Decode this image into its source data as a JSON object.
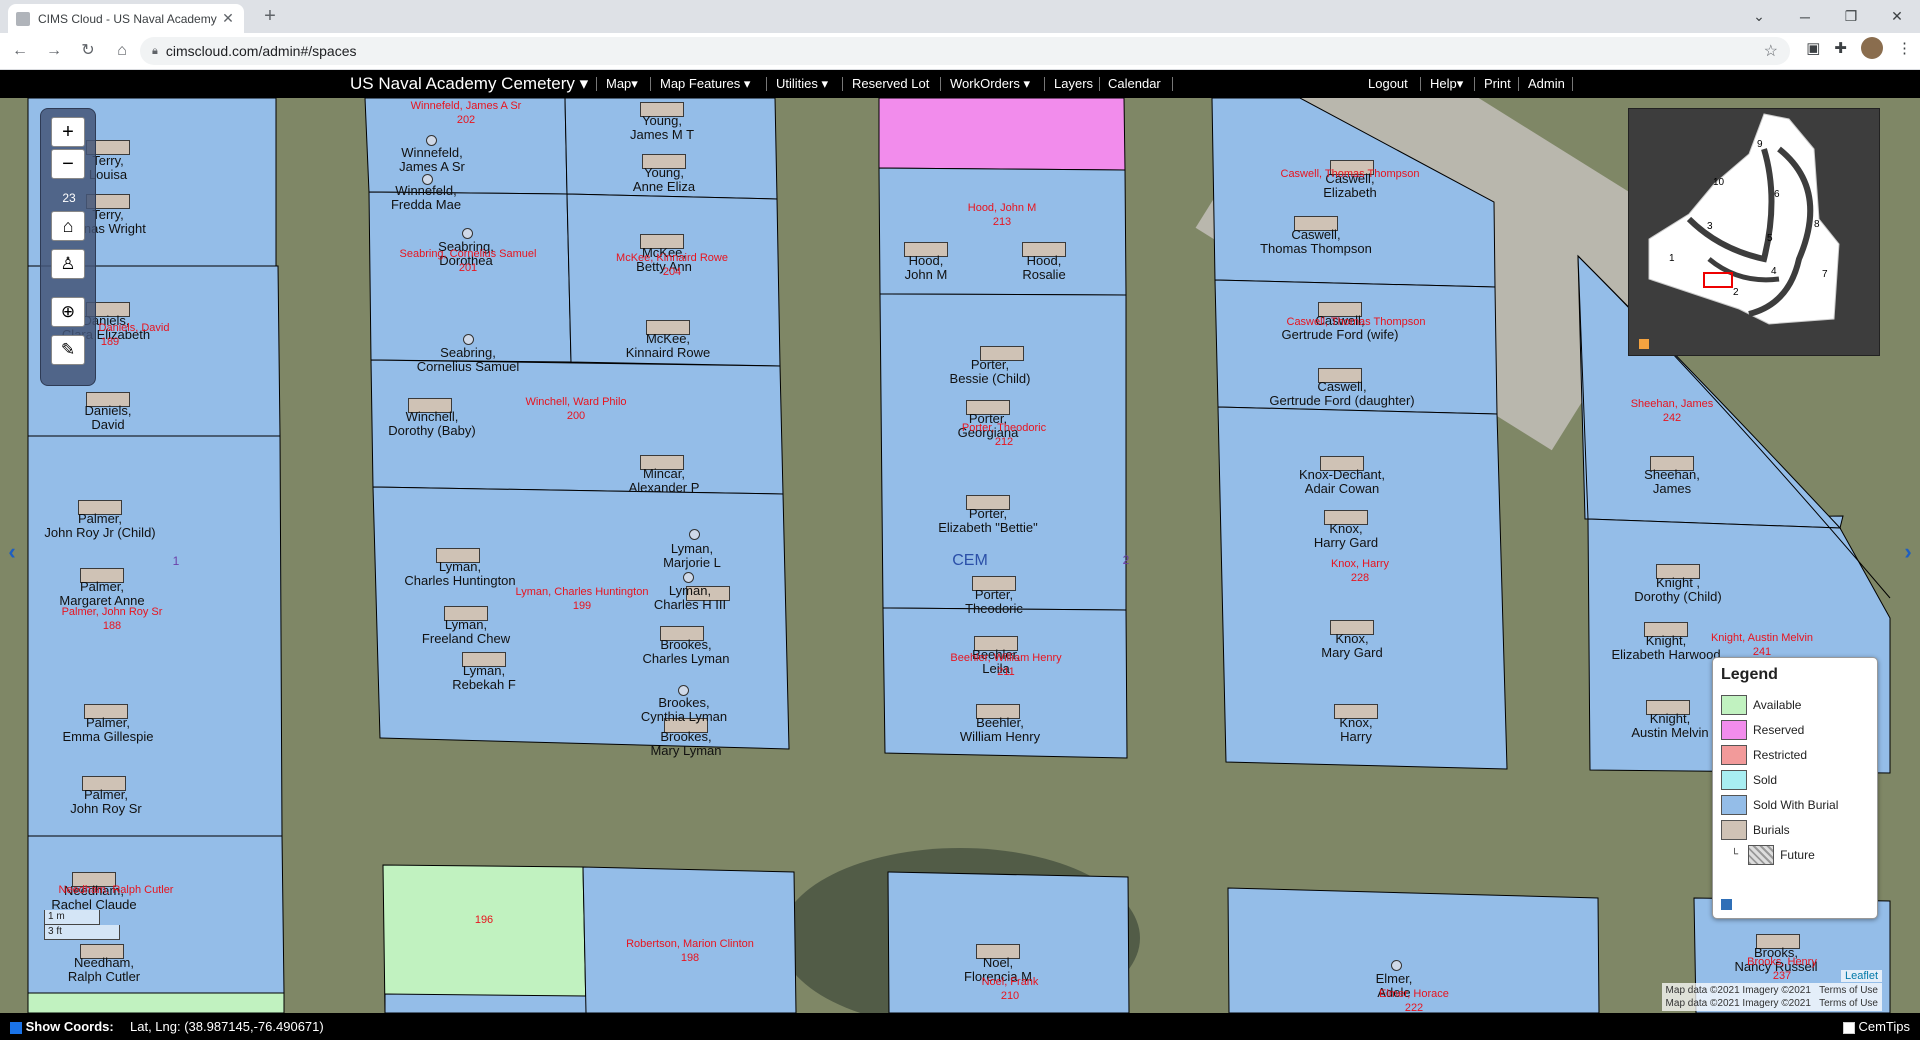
{
  "browser": {
    "tab_title": "CIMS Cloud - US Naval Academy",
    "url": "cimscloud.com/admin#/spaces"
  },
  "nav": {
    "brand": "US Naval Academy Cemetery",
    "map": "Map",
    "map_features": "Map Features",
    "utilities": "Utilities",
    "reserved_lot": "Reserved Lot",
    "work_orders": "WorkOrders",
    "layers": "Layers",
    "calendar": "Calendar",
    "logout": "Logout",
    "help": "Help",
    "print": "Print",
    "admin": "Admin"
  },
  "map": {
    "zoom_level": "23",
    "center_label": "CEM",
    "section_label_left": "1",
    "section_label_mid": "2",
    "scale": {
      "metric": "1 m",
      "imperial": "3 ft"
    },
    "attribution": [
      "Map data ©2021 Imagery ©2021",
      "Map data ©2021 Imagery ©2021"
    ],
    "terms": "Terms of Use",
    "leaflet": "Leaflet",
    "overview_numbers": [
      "9",
      "10",
      "6",
      "8",
      "3",
      "5",
      "1",
      "4",
      "7",
      "2"
    ],
    "burials": [
      {
        "name": "Terry,\nLouisa"
      },
      {
        "name": "Terry,\nJonas Wright"
      },
      {
        "name": "Daniels,\nClara Elizabeth"
      },
      {
        "name": "Daniels,\nDavid"
      },
      {
        "name": "Palmer,\nJohn Roy Jr (Child)"
      },
      {
        "name": "Palmer,\nMargaret Anne"
      },
      {
        "name": "Palmer,\nEmma Gillespie"
      },
      {
        "name": "Palmer,\nJohn Roy Sr"
      },
      {
        "name": "Needham,\nRachel Claude"
      },
      {
        "name": "Needham,\nRalph Cutler"
      },
      {
        "name": "Winnefeld,\nJames A Sr"
      },
      {
        "name": "Winnefeld,\nFredda Mae"
      },
      {
        "name": "Young,\nJames M T"
      },
      {
        "name": "Young,\nAnne Eliza"
      },
      {
        "name": "Seabring,\nDorothea"
      },
      {
        "name": "McKee,\nBetty Ann"
      },
      {
        "name": "Seabring,\nCornelius Samuel"
      },
      {
        "name": "McKee,\nKinnaird Rowe"
      },
      {
        "name": "Winchell,\nDorothy (Baby)"
      },
      {
        "name": "Mincar,\nAlexander P"
      },
      {
        "name": "Lyman,\nCharles Huntington"
      },
      {
        "name": "Lyman,\nMarjorie L"
      },
      {
        "name": "Lyman,\nCharles H III"
      },
      {
        "name": "Lyman,\nFreeland Chew"
      },
      {
        "name": "Brookes,\nCharles Lyman"
      },
      {
        "name": "Lyman,\nRebekah F"
      },
      {
        "name": "Brookes,\nCynthia Lyman"
      },
      {
        "name": "Brookes,\nMary Lyman"
      },
      {
        "name": "Hood,\nJohn M"
      },
      {
        "name": "Hood,\nRosalie"
      },
      {
        "name": "Porter,\nBessie (Child)"
      },
      {
        "name": "Porter,\nGeorgiana"
      },
      {
        "name": "Porter,\nElizabeth \"Bettie\""
      },
      {
        "name": "Porter,\nTheodoric"
      },
      {
        "name": "Beehler,\nLeila"
      },
      {
        "name": "Beehler,\nWilliam Henry"
      },
      {
        "name": "Caswell,\nElizabeth"
      },
      {
        "name": "Caswell,\nThomas Thompson"
      },
      {
        "name": "Caswell,\nGertrude Ford (wife)"
      },
      {
        "name": "Caswell,\nGertrude Ford (daughter)"
      },
      {
        "name": "Knox-Dechant,\nAdair Cowan"
      },
      {
        "name": "Knox,\nHarry Gard"
      },
      {
        "name": "Knox,\nMary Gard"
      },
      {
        "name": "Knox,\nHarry"
      },
      {
        "name": "Sheehan,\nJames"
      },
      {
        "name": "Knight ,\nDorothy (Child)"
      },
      {
        "name": "Knight,\nElizabeth Harwood"
      },
      {
        "name": "Knight,\nAustin Melvin"
      },
      {
        "name": "Noel,\nFlorencia M"
      },
      {
        "name": "Elmer,\nAdele"
      },
      {
        "name": "Brooks,\nNancy Russell"
      }
    ],
    "lots": [
      {
        "owner": "Winnefeld, James A Sr",
        "number": "202"
      },
      {
        "owner": "Seabring, Cornelius Samuel",
        "number": "201"
      },
      {
        "owner": "McKee, Kinnaird Rowe",
        "number": "204"
      },
      {
        "owner": "Winchell, Ward Philo",
        "number": "200"
      },
      {
        "owner": "Lyman, Charles Huntington",
        "number": "199"
      },
      {
        "owner": "Hood, John M",
        "number": "213"
      },
      {
        "owner": "Porter, Theodoric",
        "number": "212"
      },
      {
        "owner": "Beehler, William Henry",
        "number": "211"
      },
      {
        "owner": "Caswell, Thomas Thompson",
        "number": ""
      },
      {
        "owner": "Caswell, Thomas Thompson",
        "number": ""
      },
      {
        "owner": "Knox, Harry",
        "number": "228"
      },
      {
        "owner": "Sheehan, James",
        "number": "242"
      },
      {
        "owner": "Knight, Austin Melvin",
        "number": "241"
      },
      {
        "owner": "Palmer, John Roy Sr",
        "number": "188"
      },
      {
        "owner": "Daniels, David",
        "number": "189"
      },
      {
        "owner": "Needham, Ralph Cutler",
        "number": ""
      },
      {
        "owner": "",
        "number": "196"
      },
      {
        "owner": "Robertson, Marion Clinton",
        "number": "198"
      },
      {
        "owner": "Noel, Frank",
        "number": "210"
      },
      {
        "owner": "Elmer, Horace",
        "number": "222"
      },
      {
        "owner": "Brooks, Henry",
        "number": "237"
      }
    ]
  },
  "legend": {
    "title": "Legend",
    "items": [
      {
        "label": "Available",
        "color": "#c1f2c0"
      },
      {
        "label": "Reserved",
        "color": "#f28cec"
      },
      {
        "label": "Restricted",
        "color": "#f29a9a"
      },
      {
        "label": "Sold",
        "color": "#a8eef2"
      },
      {
        "label": "Sold With Burial",
        "color": "#94bde8"
      },
      {
        "label": "Burials",
        "color": "#cfc2b5"
      },
      {
        "label": "Future",
        "color": "#999999"
      }
    ]
  },
  "status": {
    "show_coords": "Show Coords:",
    "coords": "Lat, Lng: (38.987145,-76.490671)",
    "cemtips": "CemTips"
  }
}
